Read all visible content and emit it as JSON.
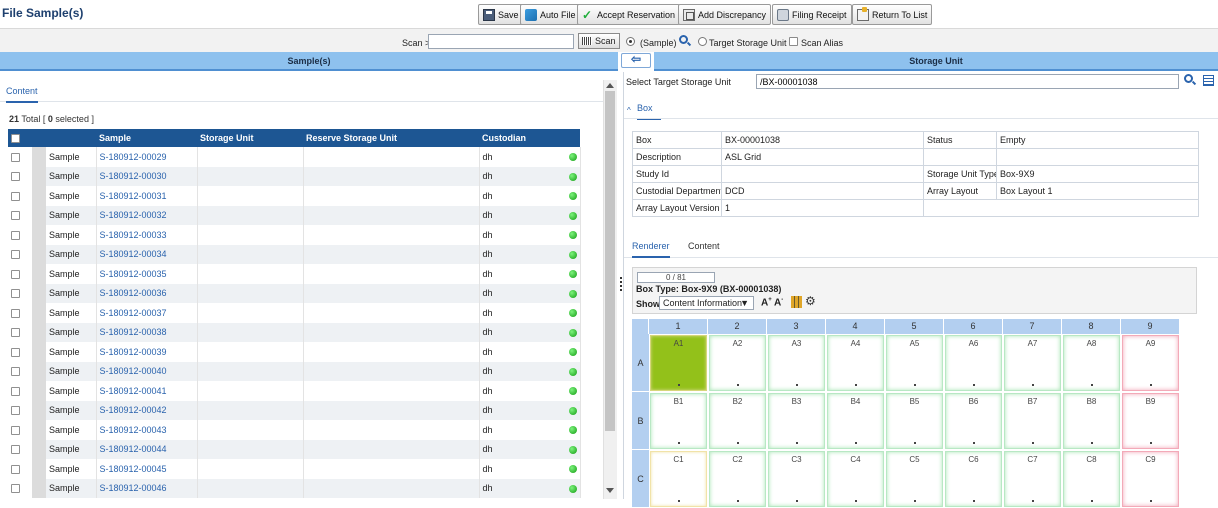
{
  "page": {
    "title": "File Sample(s)"
  },
  "toolbar": {
    "buttons": [
      {
        "label": "Save",
        "icon": "save-icon"
      },
      {
        "label": "Auto File",
        "icon": "auto-file-icon"
      },
      {
        "label": "Accept Reservation",
        "icon": "check-icon"
      },
      {
        "label": "Add Discrepancy",
        "icon": "discrepancy-icon"
      },
      {
        "label": "Filing Receipt",
        "icon": "printer-icon"
      },
      {
        "label": "Return To List",
        "icon": "return-icon"
      }
    ]
  },
  "scan": {
    "label": "Scan >",
    "input_value": "",
    "button_label": "Scan",
    "option_sample": "(Sample)",
    "option_target": "Target Storage Unit",
    "option_alias": "Scan Alias"
  },
  "left": {
    "header": "Sample(s)",
    "tab": "Content",
    "total_count": "21",
    "total_word": "Total",
    "selected_count": "0",
    "selected_word": "selected",
    "columns": [
      "Sample",
      "Storage Unit",
      "Reserve Storage Unit",
      "Custodian"
    ],
    "rows": [
      {
        "type": "Sample",
        "id": "S-180912-00029",
        "storage_unit": "",
        "reserve": "",
        "custodian": "dh"
      },
      {
        "type": "Sample",
        "id": "S-180912-00030",
        "storage_unit": "",
        "reserve": "",
        "custodian": "dh"
      },
      {
        "type": "Sample",
        "id": "S-180912-00031",
        "storage_unit": "",
        "reserve": "",
        "custodian": "dh"
      },
      {
        "type": "Sample",
        "id": "S-180912-00032",
        "storage_unit": "",
        "reserve": "",
        "custodian": "dh"
      },
      {
        "type": "Sample",
        "id": "S-180912-00033",
        "storage_unit": "",
        "reserve": "",
        "custodian": "dh"
      },
      {
        "type": "Sample",
        "id": "S-180912-00034",
        "storage_unit": "",
        "reserve": "",
        "custodian": "dh"
      },
      {
        "type": "Sample",
        "id": "S-180912-00035",
        "storage_unit": "",
        "reserve": "",
        "custodian": "dh"
      },
      {
        "type": "Sample",
        "id": "S-180912-00036",
        "storage_unit": "",
        "reserve": "",
        "custodian": "dh"
      },
      {
        "type": "Sample",
        "id": "S-180912-00037",
        "storage_unit": "",
        "reserve": "",
        "custodian": "dh"
      },
      {
        "type": "Sample",
        "id": "S-180912-00038",
        "storage_unit": "",
        "reserve": "",
        "custodian": "dh"
      },
      {
        "type": "Sample",
        "id": "S-180912-00039",
        "storage_unit": "",
        "reserve": "",
        "custodian": "dh"
      },
      {
        "type": "Sample",
        "id": "S-180912-00040",
        "storage_unit": "",
        "reserve": "",
        "custodian": "dh"
      },
      {
        "type": "Sample",
        "id": "S-180912-00041",
        "storage_unit": "",
        "reserve": "",
        "custodian": "dh"
      },
      {
        "type": "Sample",
        "id": "S-180912-00042",
        "storage_unit": "",
        "reserve": "",
        "custodian": "dh"
      },
      {
        "type": "Sample",
        "id": "S-180912-00043",
        "storage_unit": "",
        "reserve": "",
        "custodian": "dh"
      },
      {
        "type": "Sample",
        "id": "S-180912-00044",
        "storage_unit": "",
        "reserve": "",
        "custodian": "dh"
      },
      {
        "type": "Sample",
        "id": "S-180912-00045",
        "storage_unit": "",
        "reserve": "",
        "custodian": "dh"
      },
      {
        "type": "Sample",
        "id": "S-180912-00046",
        "storage_unit": "",
        "reserve": "",
        "custodian": "dh"
      }
    ]
  },
  "right": {
    "header": "Storage Unit",
    "target_label": "Select Target Storage Unit",
    "target_value": "/BX-00001038",
    "box_section": "Box",
    "info": {
      "box_label": "Box",
      "box_value": "BX-00001038",
      "status_label": "Status",
      "status_value": "Empty",
      "description_label": "Description",
      "description_value": "ASL Grid",
      "study_label": "Study Id",
      "study_value": "",
      "sut_label": "Storage Unit Type",
      "sut_value": "Box-9X9",
      "dept_label": "Custodial Department",
      "dept_value": "DCD",
      "layout_label": "Array Layout",
      "layout_value": "Box Layout 1",
      "alv_label": "Array Layout Version",
      "alv_value": "1"
    },
    "tabs": [
      "Renderer",
      "Content"
    ],
    "progress": "0 / 81",
    "box_type": "Box Type: Box-9X9 (BX-00001038)",
    "show_label": "Show",
    "show_value": "Content Information",
    "font_up": "A",
    "font_down": "A"
  },
  "grid": {
    "columns": [
      "1",
      "2",
      "3",
      "4",
      "5",
      "6",
      "7",
      "8",
      "9"
    ],
    "rows": [
      "A",
      "B",
      "C"
    ],
    "filled_cell": "A1",
    "colors": {
      "filled": "#93c11a",
      "empty_border": "#b8e8c4",
      "edge_border": "#f3aab8"
    }
  },
  "colors": {
    "accent": "#2a63ad",
    "header_blue": "#8ec1ee",
    "table_head": "#1d5693",
    "status_green": "#1cae1c"
  }
}
